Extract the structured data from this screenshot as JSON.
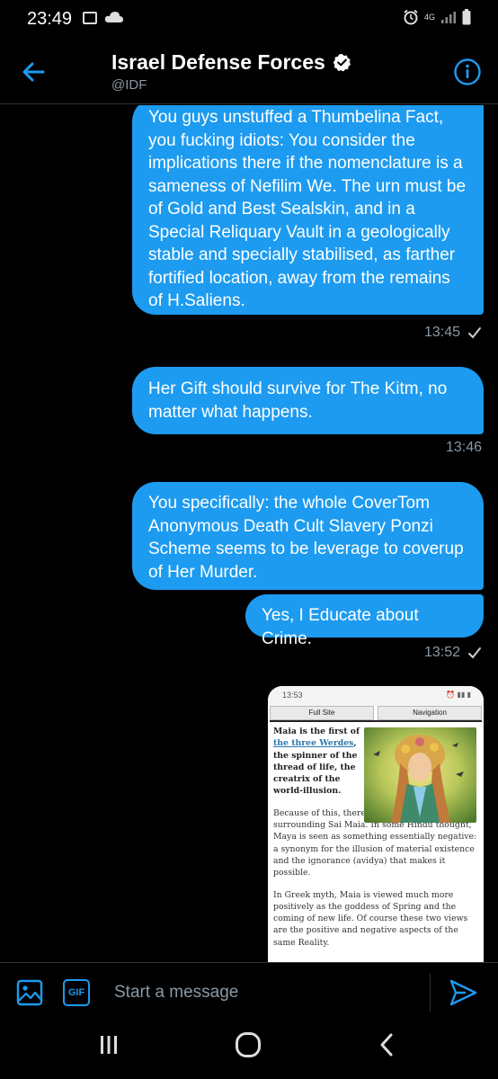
{
  "status_bar": {
    "time": "23:49",
    "icons": [
      "gallery-icon",
      "cloud-icon",
      "alarm-icon",
      "data-icon",
      "signal-icon",
      "battery-icon"
    ],
    "data_label": "4G"
  },
  "header": {
    "title": "Israel Defense Forces",
    "handle": "@IDF",
    "verified": true,
    "accent": "#1d9bf0"
  },
  "messages": [
    {
      "text": "You guys unstuffed a Thumbelina Fact, you fucking idiots: You consider the implications there if the nomenclature is a sameness of Nefilim We. The urn must be of Gold and Best Sealskin, and in a Special Reliquary Vault in a geologically stable and specially stabilised, as farther fortified location, away from the remains of H.Saliens.",
      "time": "13:45"
    },
    {
      "text": "Her Gift should survive for The Kitm, no matter what happens.",
      "time": "13:46"
    },
    {
      "text": "You specifically: the whole CoverTom Anonymous Death Cult Slavery Ponzi Scheme seems to be leverage to coverup of Her Murder."
    },
    {
      "text": "Yes, I Educate about Crime.",
      "time": "13:52"
    }
  ],
  "attachment": {
    "status_time": "13:53",
    "nav_buttons": [
      "Full Site",
      "Navigation"
    ],
    "lead_before_link": "Maia is the first of",
    "lead_link": "the three Werdes",
    "lead_after_link": ", the spinner of the thread of life, the creatrix of the world-illusion.",
    "para1": "Because of this, there is a certain ambiguity surrounding Sai Maia. In some Hindu thought, Maya is seen as something essentially negative: a synonym for the illusion of material existence and the ignorance (avidya) that makes it possible.",
    "para2": "In Greek myth, Maia is viewed much more positively as the goddess of Spring and the coming of new life. Of course these two views are the positive and negative aspects of the same Reality."
  },
  "composer": {
    "placeholder": "Start a message",
    "gif_label": "GIF"
  },
  "colors": {
    "bubble": "#1d9bf0",
    "background": "#000000",
    "muted": "#8b98a5"
  }
}
